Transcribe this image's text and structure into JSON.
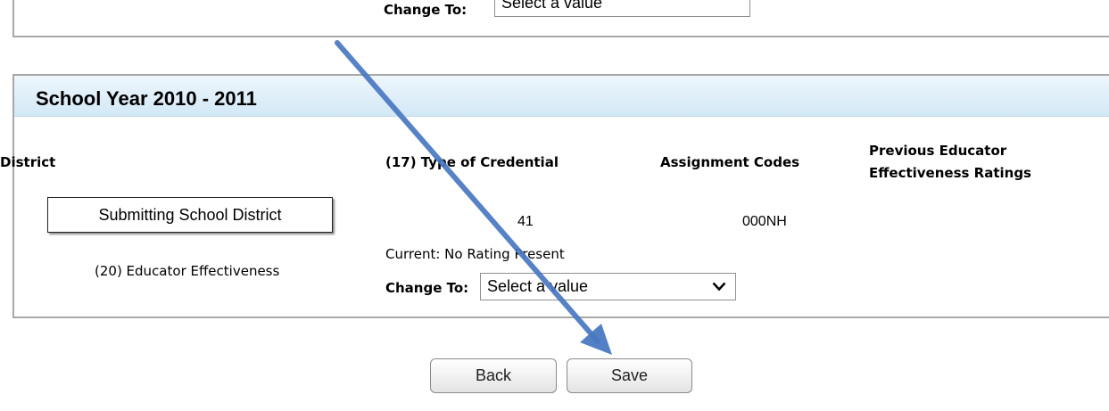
{
  "top_section": {
    "change_to_label": "Change To:",
    "select_value": "Select a value"
  },
  "school_year": {
    "title": "School Year 2010 - 2011",
    "columns": {
      "district": "District",
      "credential": "(17) Type of Credential",
      "assignment": "Assignment Codes",
      "previous_ratings_line1": "Previous Educator",
      "previous_ratings_line2": "Effectiveness Ratings"
    },
    "submitting_district": "Submitting School District",
    "credential_value": "41",
    "assignment_value": "000NH",
    "effectiveness_label": "(20) Educator Effectiveness",
    "current_rating": "Current: No Rating Present",
    "change_to_label": "Change To:",
    "select_value": "Select a value"
  },
  "actions": {
    "back": "Back",
    "save": "Save"
  },
  "colors": {
    "band_top": "#eef6fc",
    "band_bottom": "#d2e8f6",
    "annotation_arrow": "#4a78c2"
  },
  "icons": {
    "dropdown": "chevron-down-icon",
    "annotation": "arrow-annotation"
  }
}
